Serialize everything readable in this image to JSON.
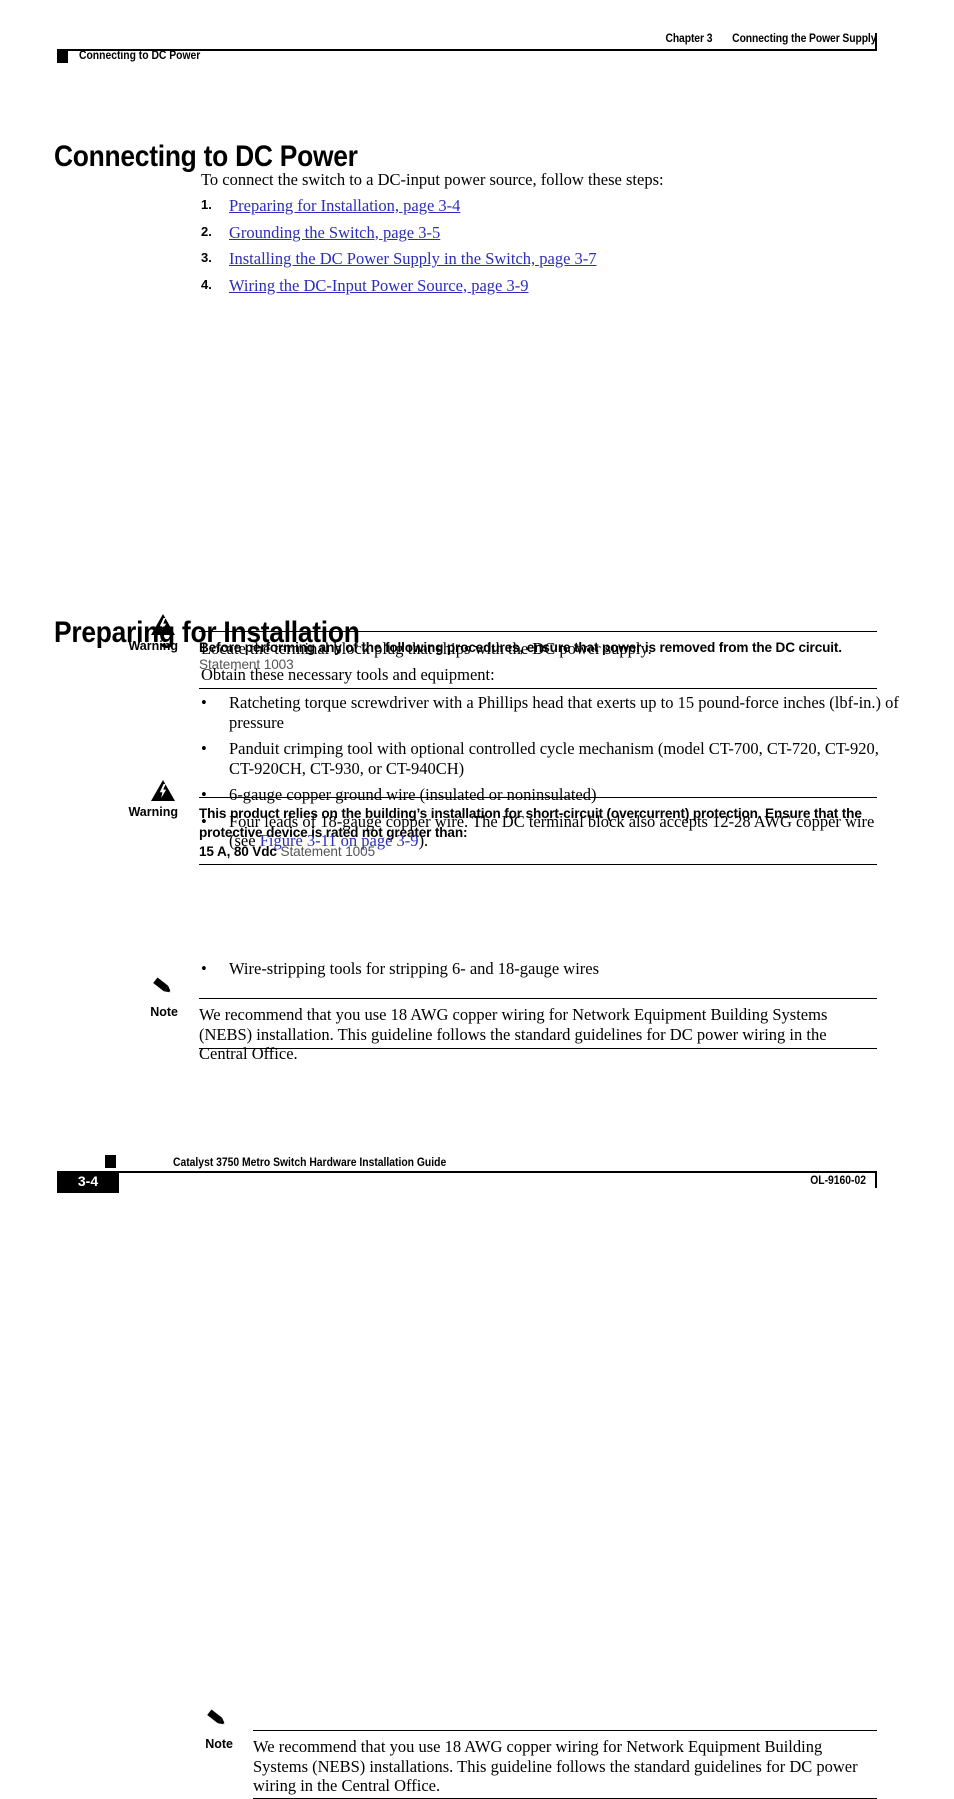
{
  "header": {
    "chapter_number": "Chapter 3",
    "chapter_title": "Connecting the Power Supply",
    "running_section": "Connecting to DC Power"
  },
  "main_heading": "Connecting to DC Power",
  "intro": "To connect the switch to a DC-input power source, follow these steps:",
  "steps": [
    {
      "number": "1.",
      "link": "Preparing for Installation, page 3-4"
    },
    {
      "number": "2.",
      "link": "Grounding the Switch, page 3-5"
    },
    {
      "number": "3.",
      "link": "Installing the DC Power Supply in the Switch, page 3-7"
    },
    {
      "number": "4.",
      "link": "Wiring the DC-Input Power Source, page 3-9"
    }
  ],
  "warning1": {
    "label": "Warning",
    "icon": "warning-triangle-lightning-icon",
    "text": "Before performing any of the following procedures, ensure that power is removed from the DC circuit.",
    "statement": "Statement 1003"
  },
  "warning2": {
    "label": "Warning",
    "icon": "warning-triangle-lightning-icon",
    "text": "This product relies on the building’s installation for short-circuit (overcurrent) protection. Ensure that the protective device is rated not greater than:",
    "rating": "15 A, 80 Vdc",
    "statement": "Statement 1005"
  },
  "note1": {
    "label": "Note",
    "icon": "pencil-icon",
    "text": "We recommend that you use 18 AWG copper wiring for Network Equipment Building Systems (NEBS) installation. This guideline follows the standard guidelines for DC power wiring in the Central Office."
  },
  "section_heading": "Preparing for Installation",
  "locate_text": "Locate the terminal block plug that ships with the DC power supply.",
  "obtain_text": "Obtain these necessary tools and equipment:",
  "bullets": [
    {
      "dot": "•",
      "text": "Ratcheting torque screwdriver with a Phillips head that exerts up to 15 pound-force inches (lbf-in.) of pressure"
    },
    {
      "dot": "•",
      "text": "Panduit crimping tool with optional controlled cycle mechanism (model CT-700, CT-720, CT-920, CT-920CH, CT-930, or CT-940CH)"
    },
    {
      "dot": "•",
      "text": "6-gauge copper ground wire (insulated or noninsulated)"
    }
  ],
  "bullet_fourth": {
    "dot": "•",
    "text_before": "Four leads of 18-gauge copper wire. The DC terminal block also accepts 12-28 AWG copper wire (see ",
    "link": "Figure 3-11 on page 3-9",
    "text_after": ")."
  },
  "note2": {
    "label": "Note",
    "icon": "pencil-icon",
    "text": "We recommend that you use 18 AWG copper wiring for Network Equipment Building Systems (NEBS) installations. This guideline follows the standard guidelines for DC power wiring in the Central Office."
  },
  "bullet_last": {
    "dot": "•",
    "text": "Wire-stripping tools for stripping 6- and 18-gauge wires"
  },
  "footer": {
    "document_title": "Catalyst 3750 Metro Switch Hardware Installation Guide",
    "page_number": "3-4",
    "doc_id": "OL-9160-02"
  },
  "colors": {
    "link": "#2d2dbb",
    "text": "#000000",
    "statement": "#555555",
    "rule": "#000000",
    "page_background": "#ffffff"
  }
}
